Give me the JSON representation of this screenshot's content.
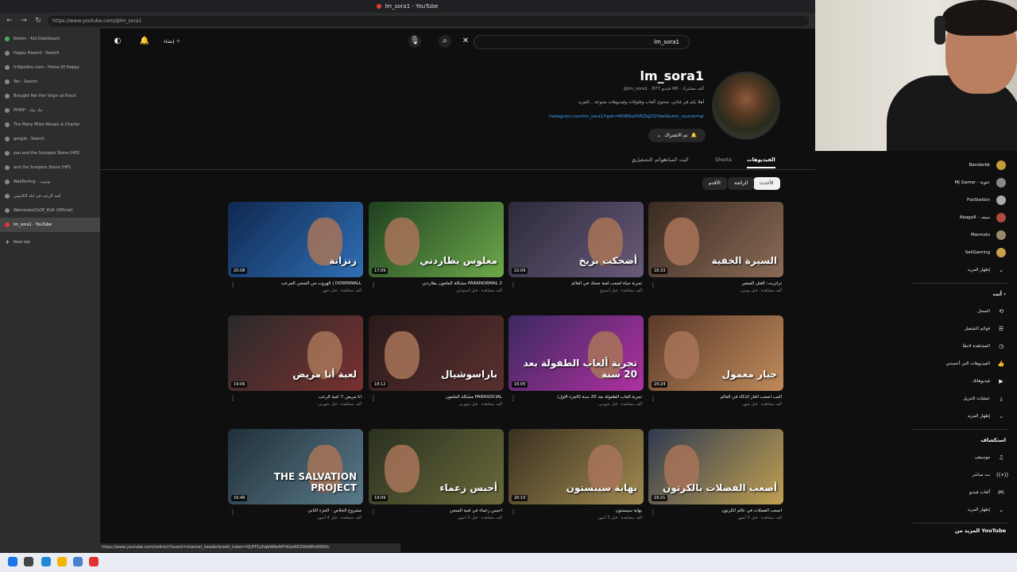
{
  "browser": {
    "window_title": "lm_sora1 - YouTube",
    "url": "https://www.youtube.com/@lm_sora1",
    "status_url": "https://www.youtube.com/redirect?event=channel_header&redir_token=QUFFLUhqbWNxNFhKdzN5ZWdNRzNSNVc",
    "tabs": [
      {
        "label": "Notion - Kid Dashboard",
        "active": false
      },
      {
        "label": "Happy Hazard - Search",
        "active": false
      },
      {
        "label": "fcl0polbnc.com - Home Of Happy",
        "active": false
      },
      {
        "label": "Yes - Search",
        "active": false
      },
      {
        "label": "Brought Her Her Virgin at Kinch",
        "active": false
      },
      {
        "label": "PHWP - تيك توك",
        "active": false
      },
      {
        "label": "The Many Miles Mosaic & Charter",
        "active": false
      },
      {
        "label": "google - Search",
        "active": false
      },
      {
        "label": "you and the Scorpion Stone (HPS",
        "active": false
      },
      {
        "label": "and the Scorpion Stone (HPS",
        "active": false
      },
      {
        "label": "WallPerling - يوتيوب",
        "active": false
      },
      {
        "label": "لعبة الرعب في ليلة الكابوس",
        "active": false
      },
      {
        "label": "Wemoobal2LOE_KUK (Official)",
        "active": false
      },
      {
        "label": "lm_sora1 - YouTube",
        "active": true
      },
      {
        "label": "New tab",
        "active": false
      }
    ]
  },
  "youtube": {
    "top": {
      "create_label": "إنشاء",
      "search_query": "lm_sora1"
    },
    "channel": {
      "name": "lm_sora1",
      "meta": "@lm_sora1 · 877 ألف مشترك · 98 فيديو",
      "description": "أهلا بكم في قناتي، محتوى ألعاب وفلوقات وفيديوهات متنوعة ...المزيد",
      "link": "instagram.com/lm_sora1?igsh=MDB5eDV6ZkJjY2VkeiI&utm_source=qr",
      "subscribe_label": "تم الاشتراك"
    },
    "channel_tabs": [
      {
        "label": "الفيديوهات",
        "active": true
      },
      {
        "label": "Shorts",
        "active": false
      },
      {
        "label": "البث المباشر",
        "active": false
      },
      {
        "label": "قوائم التشغيل",
        "active": false
      }
    ],
    "chips": [
      "الأحدث",
      "الرائجة",
      "الأقدم"
    ],
    "videos": [
      {
        "thumb_text": "السيرة الخفية",
        "duration": "18:33",
        "title": "ترانزيت: القتل الصغير",
        "meta": "ألف مشاهدة · قبل يومين",
        "colors": [
          "#3a2a22",
          "#8a6b55"
        ]
      },
      {
        "thumb_text": "أضحكت بريخ",
        "duration": "22:09",
        "title": "تجربة حياة أصعب لعبة ضحك في العالم",
        "meta": "ألف مشاهدة · قبل أسبوع",
        "colors": [
          "#2b2a3a",
          "#6a5a7a"
        ]
      },
      {
        "thumb_text": "معلوس يطاردني",
        "duration": "17:09",
        "title": "مشكلة الملعون يطاردني PARANORMAL 2",
        "meta": "ألف مشاهدة · قبل أسبوعين",
        "colors": [
          "#1f4020",
          "#6ca84a"
        ]
      },
      {
        "thumb_text": "زنزانة",
        "duration": "20:08",
        "title": "الهروب من السجن المرعب | DOWNWALL",
        "meta": "ألف مشاهدة · قبل شهر",
        "colors": [
          "#102850",
          "#2f6fb5"
        ]
      },
      {
        "thumb_text": "جبار معمول",
        "duration": "24:24",
        "title": "ألعب أصعب ألغاز الذكاء في العالم",
        "meta": "ألف مشاهدة · قبل شهر",
        "colors": [
          "#5a3a2a",
          "#c08a5a"
        ]
      },
      {
        "thumb_text": "تجربة ألعاب الطفولة بعد 20 سنة",
        "duration": "16:05",
        "title": "تجربة ألعاب الطفولة بعد 20 سنة (الجزء الأول)",
        "meta": "ألف مشاهدة · قبل شهرين",
        "colors": [
          "#3a2a60",
          "#b030a0"
        ]
      },
      {
        "thumb_text": "باراسوشيال",
        "duration": "18:12",
        "title": "مشكلة الملعون PARASOCIAL",
        "meta": "ألف مشاهدة · قبل شهرين",
        "colors": [
          "#2a1a1a",
          "#5a3030"
        ]
      },
      {
        "thumb_text": "لعبة أنا مريض",
        "duration": "19:06",
        "title": "أنا مريض !! لعبة الرعب",
        "meta": "ألف مشاهدة · قبل شهرين",
        "colors": [
          "#2a2a2a",
          "#7a3030"
        ]
      },
      {
        "thumb_text": "أصعب الفضلات بالكرتون",
        "duration": "19:21",
        "title": "أصعب الفضلات في عالم الكرتون",
        "meta": "ألف مشاهدة · قبل 3 أشهر",
        "colors": [
          "#303a50",
          "#c0a050"
        ]
      },
      {
        "thumb_text": "نهاية سيبستون",
        "duration": "20:10",
        "title": "نهاية سيبستون",
        "meta": "ألف مشاهدة · قبل 3 أشهر",
        "colors": [
          "#3a3020",
          "#a08a50"
        ]
      },
      {
        "thumb_text": "أحبس زعماء",
        "duration": "19:09",
        "title": "أحبس زعماء في لعبة السجن",
        "meta": "ألف مشاهدة · قبل 3 أشهر",
        "colors": [
          "#2a3020",
          "#6a6a3a"
        ]
      },
      {
        "thumb_text": "THE SALVATION PROJECT",
        "duration": "16:46",
        "title": "مشروع الخلاص - الجزء الثاني",
        "meta": "ألف مشاهدة · قبل 4 أشهر",
        "colors": [
          "#20303a",
          "#5a7a8a"
        ]
      }
    ],
    "sidebar": {
      "subscriptions": [
        {
          "name": "Bandarbk",
          "color": "#c79a3a"
        },
        {
          "name": "MJ Gamer - عنوبة",
          "color": "#888"
        },
        {
          "name": "FoxStation",
          "color": "#aaa"
        },
        {
          "name": "Abaga9 - سيف",
          "color": "#b04a3a"
        },
        {
          "name": "Marmots",
          "color": "#9a8a6a"
        },
        {
          "name": "SaliGaming",
          "color": "#caa04a"
        }
      ],
      "show_more_1": "إظهار المزيد",
      "you_header": "أنت ›",
      "you_items": [
        {
          "label": "السجل",
          "icon": "history-icon"
        },
        {
          "label": "قوائم التشغيل",
          "icon": "playlist-icon"
        },
        {
          "label": "المشاهدة لاحقًا",
          "icon": "watch-later-icon"
        },
        {
          "label": "الفيديوهات التي أعجبتني",
          "icon": "like-icon"
        },
        {
          "label": "فيديوهاتك",
          "icon": "video-icon"
        },
        {
          "label": "عمليات التنزيل",
          "icon": "download-icon"
        }
      ],
      "show_more_2": "إظهار المزيد",
      "explore_header": "استكشاف",
      "explore_items": [
        {
          "label": "موسيقى",
          "icon": "music-icon"
        },
        {
          "label": "بث مباشر",
          "icon": "live-icon"
        },
        {
          "label": "ألعاب فيديو",
          "icon": "gaming-icon"
        }
      ],
      "show_more_3": "إظهار المزيد",
      "footer_header": "المزيد من YouTube"
    }
  }
}
